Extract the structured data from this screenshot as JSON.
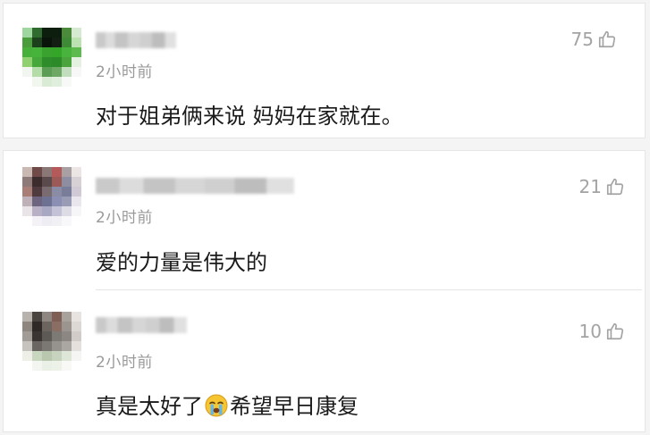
{
  "comments": [
    {
      "time": "2小时前",
      "likes": "75",
      "text": "对于姐弟俩来说 妈妈在家就在。"
    },
    {
      "time": "2小时前",
      "likes": "21",
      "text": "爱的力量是伟大的"
    },
    {
      "time": "2小时前",
      "likes": "10",
      "text_before": "真是太好了",
      "emoji": "crying-face-emoji",
      "text_after": "希望早日康复"
    }
  ],
  "colors": {
    "text": "#1a1a1a",
    "meta": "#9a9a9a",
    "like": "#a3a3a3",
    "card_border": "#e6e6e6"
  }
}
